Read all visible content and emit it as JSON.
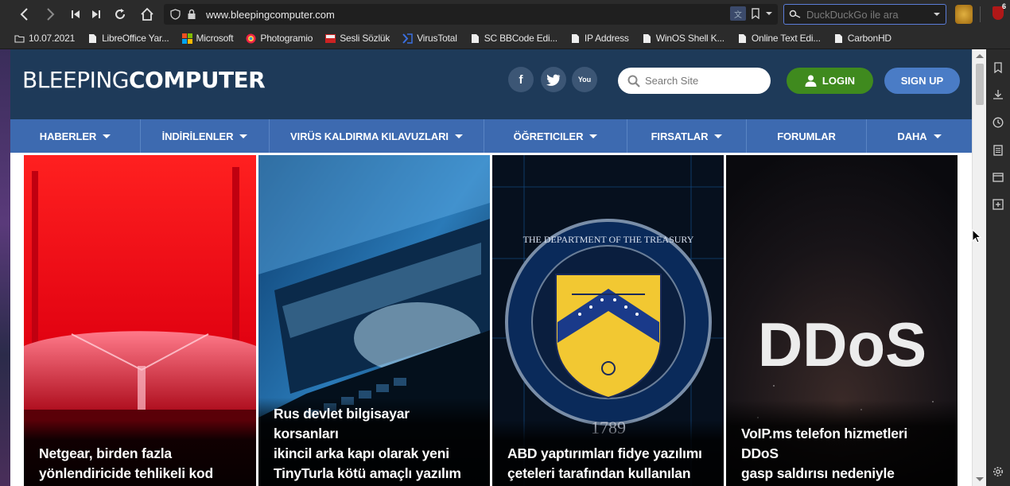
{
  "browser": {
    "url": "www.bleepingcomputer.com",
    "search_placeholder": "DuckDuckGo ile ara",
    "extension_badge": "6"
  },
  "bookmarks": [
    {
      "label": "10.07.2021",
      "icon": "folder-icon"
    },
    {
      "label": "LibreOffice Yar...",
      "icon": "page-icon"
    },
    {
      "label": "Microsoft",
      "icon": "microsoft-icon"
    },
    {
      "label": "Photogramio",
      "icon": "photogramio-icon"
    },
    {
      "label": "Sesli Sözlük",
      "icon": "sesli-icon"
    },
    {
      "label": "VirusTotal",
      "icon": "virustotal-icon"
    },
    {
      "label": "SC BBCode Edi...",
      "icon": "page-icon"
    },
    {
      "label": "IP Address",
      "icon": "page-icon"
    },
    {
      "label": "WinOS Shell K...",
      "icon": "page-icon"
    },
    {
      "label": "Online Text Edi...",
      "icon": "page-icon"
    },
    {
      "label": "CarbonHD",
      "icon": "page-icon"
    }
  ],
  "site": {
    "logo_light": "BLEEPING",
    "logo_bold": "COMPUTER",
    "search_placeholder": "Search Site",
    "login_label": "LOGIN",
    "signup_label": "SIGN UP",
    "social": [
      "f",
      "t",
      "You"
    ]
  },
  "nav": [
    {
      "label": "HABERLER",
      "dropdown": true
    },
    {
      "label": "İNDİRİLENLER",
      "dropdown": true
    },
    {
      "label": "VIRÜS KALDIRMA KILAVUZLARI",
      "dropdown": true
    },
    {
      "label": "ÖĞRETICILER",
      "dropdown": true
    },
    {
      "label": "FIRSATLAR",
      "dropdown": true
    },
    {
      "label": "FORUMLAR",
      "dropdown": false
    },
    {
      "label": "DAHA",
      "dropdown": true
    }
  ],
  "articles": [
    {
      "lines": [
        "Netgear, birden fazla",
        "yönlendiricide tehlikeli kod"
      ]
    },
    {
      "lines": [
        "Rus devlet bilgisayar korsanları",
        "ikincil arka kapı olarak yeni",
        "TinyTurla kötü amaçlı yazılım"
      ]
    },
    {
      "lines": [
        "ABD yaptırımları fidye yazılımı",
        "çeteleri tarafından kullanılan"
      ]
    },
    {
      "lines": [
        "VoIP.ms telefon hizmetleri DDoS",
        "gasp saldırısı nedeniyle"
      ]
    }
  ],
  "images": {
    "treasury_text": "THE DEPARTMENT OF THE TREASURY",
    "treasury_year": "1789",
    "ddos_text": "DDoS"
  },
  "colors": {
    "header_bg": "#1e3a59",
    "nav_bg": "#3d6ab0",
    "login_bg": "#3f8a1e",
    "signup_bg": "#4a7cc6"
  }
}
